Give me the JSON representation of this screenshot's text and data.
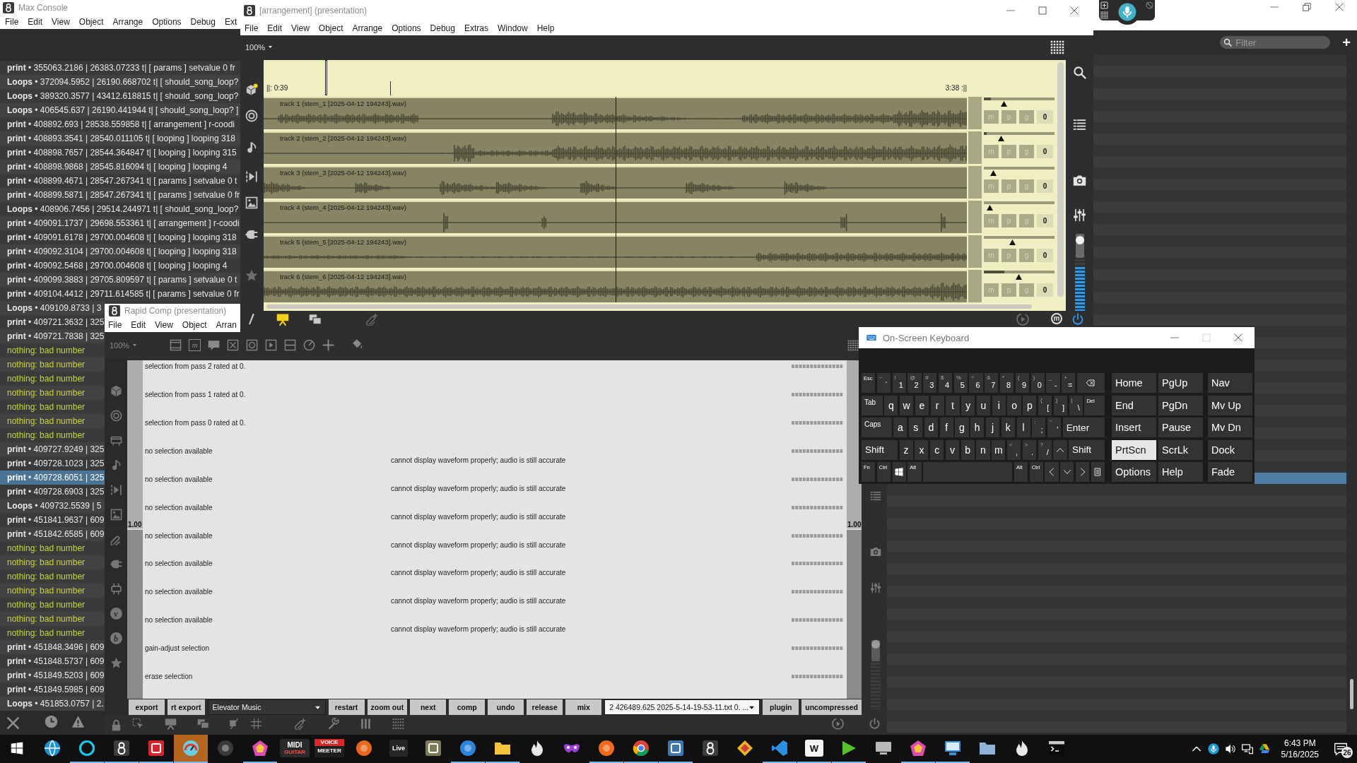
{
  "browser": {
    "search": {
      "placeholder": "Filter"
    },
    "add": "+",
    "rows": [
      {
        "selected": false
      },
      {
        "selected": false
      },
      {
        "selected": false
      },
      {
        "selected": false
      },
      {
        "selected": false
      },
      {
        "selected": false
      },
      {
        "selected": false
      },
      {
        "selected": false
      },
      {
        "selected": false
      },
      {
        "selected": false
      },
      {
        "selected": false
      },
      {
        "selected": false
      },
      {
        "selected": false
      },
      {
        "selected": false
      },
      {
        "selected": false
      },
      {
        "selected": false
      },
      {
        "selected": false
      },
      {
        "selected": false
      },
      {
        "selected": false
      },
      {
        "selected": false
      },
      {
        "selected": false
      },
      {
        "selected": false
      },
      {
        "selected": false
      },
      {
        "selected": false
      },
      {
        "selected": false
      },
      {
        "selected": false
      },
      {
        "selected": false
      },
      {
        "selected": false
      },
      {
        "selected": false
      },
      {
        "selected": false
      },
      {
        "selected": false
      },
      {
        "selected": false
      },
      {
        "selected": false
      },
      {
        "selected": false
      },
      {
        "selected": false
      },
      {
        "selected": false
      },
      {
        "selected": false
      },
      {
        "selected": true
      },
      {
        "selected": false
      },
      {
        "selected": false
      },
      {
        "selected": false
      },
      {
        "selected": false
      },
      {
        "selected": false
      },
      {
        "selected": false
      },
      {
        "selected": false
      },
      {
        "selected": false
      },
      {
        "selected": false
      },
      {
        "selected": false
      },
      {
        "selected": false
      },
      {
        "selected": false
      },
      {
        "selected": false
      },
      {
        "selected": false
      },
      {
        "selected": false
      },
      {
        "selected": false
      },
      {
        "selected": false
      },
      {
        "selected": false
      },
      {
        "selected": false
      },
      {
        "selected": false
      },
      {
        "selected": false
      },
      {
        "selected": false
      }
    ]
  },
  "console": {
    "title": "Max Console",
    "menu": [
      "File",
      "Edit",
      "View",
      "Object",
      "Arrange",
      "Options",
      "Debug",
      "Ext"
    ],
    "rows": [
      {
        "kind": "print",
        "text": "**print** • 355063.2186 | 26383.07233 t| [ params ] setvalue 0 fr",
        "selected": false
      },
      {
        "kind": "loops",
        "text": "**Loops** • 372094.5952 | 26190.668702 t| [ should_song_loop?",
        "selected": false
      },
      {
        "kind": "loops",
        "text": "**Loops** • 389320.3577 | 43412.618815 t| [ should_song_loop?",
        "selected": false
      },
      {
        "kind": "loops",
        "text": "**Loops** • 406545.637 | 26190.441944 t| [ should_song_loop? ]",
        "selected": false
      },
      {
        "kind": "print",
        "text": "**print** • 408892.693 | 28538.559858 t| [ arrangement ] r-coodi",
        "selected": false
      },
      {
        "kind": "print",
        "text": "**print** • 408893.3541 | 28540.011105 t| [ looping ] looping 318",
        "selected": false
      },
      {
        "kind": "print",
        "text": "**print** • 408898.7657 | 28544.364847 t| [ looping ] looping 315",
        "selected": false
      },
      {
        "kind": "print",
        "text": "**print** • 408898.9868 | 28545.816094 t| [ looping ] looping 4",
        "selected": false
      },
      {
        "kind": "print",
        "text": "**print** • 408899.4671 | 28547.267341 t| [ params ] setvalue 0 t",
        "selected": false
      },
      {
        "kind": "print",
        "text": "**print** • 408899.5871 | 28547.267341 t| [ params ] setvalue 0 fr",
        "selected": false
      },
      {
        "kind": "loops",
        "text": "**Loops** • 408906.7456 | 29514.244971 t| [ should_song_loop?",
        "selected": false
      },
      {
        "kind": "print",
        "text": "**print** • 409091.1737 | 29698.553361 t| [ arrangement ] r-coodi",
        "selected": false
      },
      {
        "kind": "print",
        "text": "**print** • 409091.6178 | 29700.004608 t| [ looping ] looping 318",
        "selected": false
      },
      {
        "kind": "print",
        "text": "**print** • 409092.3104 | 29700.004608 t| [ looping ] looping 318",
        "selected": false
      },
      {
        "kind": "print",
        "text": "**print** • 409092.5468 | 29700.004608 t| [ looping ] looping 4",
        "selected": false
      },
      {
        "kind": "print",
        "text": "**print** • 409099.3883 | 29705.809597 t| [ params ] setvalue 0 t",
        "selected": false
      },
      {
        "kind": "print",
        "text": "**print** • 409104.4412 | 29711.614585 t| [ params ] setvalue 0 fr",
        "selected": false
      },
      {
        "kind": "loops",
        "text": "**Loops** • 409109.8733 | 3",
        "selected": false
      },
      {
        "kind": "print",
        "text": "**print** • 409721.3632 | 325",
        "selected": false
      },
      {
        "kind": "print",
        "text": "**print** • 409721.7838 | 325",
        "selected": false
      },
      {
        "kind": "error",
        "text": "nothing: bad number",
        "selected": false
      },
      {
        "kind": "error",
        "text": "nothing: bad number",
        "selected": false
      },
      {
        "kind": "error",
        "text": "nothing: bad number",
        "selected": false
      },
      {
        "kind": "error",
        "text": "nothing: bad number",
        "selected": false
      },
      {
        "kind": "error",
        "text": "nothing: bad number",
        "selected": false
      },
      {
        "kind": "error",
        "text": "nothing: bad number",
        "selected": false
      },
      {
        "kind": "error",
        "text": "nothing: bad number",
        "selected": false
      },
      {
        "kind": "print",
        "text": "**print** • 409727.9249 | 325",
        "selected": false
      },
      {
        "kind": "print",
        "text": "**print** • 409728.1023 | 325",
        "selected": false
      },
      {
        "kind": "print",
        "text": "**print** • 409728.6051 | 325",
        "selected": true
      },
      {
        "kind": "print",
        "text": "**print** • 409728.6903 | 325",
        "selected": false
      },
      {
        "kind": "loops",
        "text": "**Loops** • 409732.5539 | 5",
        "selected": false
      },
      {
        "kind": "print",
        "text": "**print** • 451841.9637 | 609",
        "selected": false
      },
      {
        "kind": "print",
        "text": "**print** • 451842.6585 | 609",
        "selected": false
      },
      {
        "kind": "error",
        "text": "nothing: bad number",
        "selected": false
      },
      {
        "kind": "error",
        "text": "nothing: bad number",
        "selected": false
      },
      {
        "kind": "error",
        "text": "nothing: bad number",
        "selected": false
      },
      {
        "kind": "error",
        "text": "nothing: bad number",
        "selected": false
      },
      {
        "kind": "error",
        "text": "nothing: bad number",
        "selected": false
      },
      {
        "kind": "error",
        "text": "nothing: bad number",
        "selected": false
      },
      {
        "kind": "error",
        "text": "nothing: bad number",
        "selected": false
      },
      {
        "kind": "print",
        "text": "**print** • 451848.3496 | 609",
        "selected": false
      },
      {
        "kind": "print",
        "text": "**print** • 451848.5737 | 609",
        "selected": false
      },
      {
        "kind": "print",
        "text": "**print** • 451849.5203 | 609",
        "selected": false
      },
      {
        "kind": "print",
        "text": "**print** • 451849.5985 | 609",
        "selected": false
      },
      {
        "kind": "loops",
        "text": "**Loops** • 451853.0757 | 2.",
        "selected": false
      }
    ]
  },
  "rapid_comp": {
    "title": "Rapid Comp (presentation)",
    "menu": [
      "File",
      "Edit",
      "View",
      "Object",
      "Arran"
    ],
    "zoom": "100%",
    "message_tool": "m",
    "badges": [
      "v",
      "b"
    ],
    "left_slider": {
      "value": "1.00",
      "level": 0.5
    },
    "right_slider": {
      "value": "1.00",
      "level": 0.5
    },
    "rows": [
      {
        "label": "selection from pass 2 rated at 0."
      },
      {
        "label": "selection from pass 1 rated at 0."
      },
      {
        "label": "selection from pass 0 rated at 0."
      },
      {
        "label": "no selection available",
        "note": "cannot display waveform properly; audio is still accurate"
      },
      {
        "label": "no selection available",
        "note": "cannot display waveform properly; audio is still accurate"
      },
      {
        "label": "no selection available",
        "note": "cannot display waveform properly; audio is still accurate"
      },
      {
        "label": "no selection available",
        "note": "cannot display waveform properly; audio is still accurate"
      },
      {
        "label": "no selection available",
        "note": "cannot display waveform properly; audio is still accurate"
      },
      {
        "label": "no selection available",
        "note": "cannot display waveform properly; audio is still accurate"
      },
      {
        "label": "no selection available",
        "note": "cannot display waveform properly; audio is still accurate"
      },
      {
        "label": "gain-adjust selection"
      },
      {
        "label": "erase selection"
      }
    ],
    "controls": [
      {
        "kind": "button",
        "label": "export"
      },
      {
        "kind": "button",
        "label": "rt export"
      },
      {
        "kind": "dropdown",
        "label": "Elevator Music"
      },
      {
        "kind": "button",
        "label": "restart"
      },
      {
        "kind": "button",
        "label": "zoom out"
      },
      {
        "kind": "button",
        "label": "next"
      },
      {
        "kind": "button",
        "label": "comp"
      },
      {
        "kind": "button",
        "label": "undo"
      },
      {
        "kind": "button",
        "label": "release"
      },
      {
        "kind": "button",
        "label": "mix"
      },
      {
        "kind": "file-dropdown",
        "label": "2 426489.625 2025-5-14-19-53-11.txt 0. ..."
      },
      {
        "kind": "button",
        "label": "plugin"
      },
      {
        "kind": "button",
        "label": "uncompressed"
      }
    ],
    "output": {
      "gain": {
        "level": 0.8
      }
    }
  },
  "arrangement": {
    "title": "[arrangement] (presentation)",
    "menu": [
      "File",
      "Edit",
      "View",
      "Object",
      "Arrange",
      "Options",
      "Debug",
      "Extras",
      "Window",
      "Help"
    ],
    "zoom": "100%",
    "loop_start": "||: 0:39",
    "loop_end": "3:38 :||",
    "marker": {
      "level": 0.087
    },
    "cursor": {
      "level": 0.18
    },
    "playhead": {
      "level": 0.5
    },
    "letter_button": "m",
    "tracks": [
      {
        "label": "track 1 (stem_1 [2025-04-12 194243].wav)",
        "meter": {
          "level": 0.1
        },
        "gain": {
          "level": 0.28
        },
        "buttons": [
          "m",
          "p",
          "g"
        ],
        "value": "0"
      },
      {
        "label": "track 2 (stem_2 [2025-04-12 194243].wav)",
        "meter": {
          "level": 0.04
        },
        "gain": {
          "level": 0.24
        },
        "buttons": [
          "m",
          "p",
          "g"
        ],
        "value": "0"
      },
      {
        "label": "track 3 (stem_3 [2025-04-12 194243].wav)",
        "gain": {
          "level": 0.13
        },
        "buttons": [
          "m",
          "p",
          "g"
        ],
        "value": "0"
      },
      {
        "label": "track 4 (stem_4 [2025-04-12 194243].wav)",
        "gain": {
          "level": 0.08
        },
        "buttons": [
          "m",
          "p",
          "g"
        ],
        "value": "0"
      },
      {
        "label": "track 5 (stem_5 [2025-04-12 194243].wav)",
        "gain": {
          "level": 0.4
        },
        "buttons": [
          "m",
          "p",
          "g"
        ],
        "value": "0"
      },
      {
        "label": "track 6 (stem_6 [2025-04-12 194243].wav)",
        "meter": {
          "level": 0.29
        },
        "gain": {
          "level": 0.49
        },
        "buttons": [
          "m",
          "p",
          "g"
        ],
        "value": "0"
      }
    ],
    "output": {
      "gain": {
        "level": 0.75
      },
      "meter": {
        "level": 0.85
      }
    }
  },
  "keyboard": {
    "title": "On-Screen Keyboard",
    "main_rows": [
      [
        {
          "kind": "tiny",
          "label": "Esc"
        },
        {
          "kind": "dual",
          "shift": "~",
          "label": "`"
        },
        {
          "kind": "dual",
          "shift": "!",
          "label": "1"
        },
        {
          "kind": "dual",
          "shift": "@",
          "label": "2"
        },
        {
          "kind": "dual",
          "shift": "#",
          "label": "3"
        },
        {
          "kind": "dual",
          "shift": "$",
          "label": "4"
        },
        {
          "kind": "dual",
          "shift": "%",
          "label": "5"
        },
        {
          "kind": "dual",
          "shift": "^",
          "label": "6"
        },
        {
          "kind": "dual",
          "shift": "&",
          "label": "7"
        },
        {
          "kind": "dual",
          "shift": "*",
          "label": "8"
        },
        {
          "kind": "dual",
          "shift": "(",
          "label": "9"
        },
        {
          "kind": "dual",
          "shift": ")",
          "label": "0"
        },
        {
          "kind": "dual",
          "shift": "_",
          "label": "-"
        },
        {
          "kind": "dual",
          "shift": "+",
          "label": "="
        },
        {
          "kind": "backspace"
        }
      ],
      [
        {
          "kind": "small",
          "label": "Tab"
        },
        {
          "kind": "letter",
          "label": "q"
        },
        {
          "kind": "letter",
          "label": "w"
        },
        {
          "kind": "letter",
          "label": "e"
        },
        {
          "kind": "letter",
          "label": "r"
        },
        {
          "kind": "letter",
          "label": "t"
        },
        {
          "kind": "letter",
          "label": "y"
        },
        {
          "kind": "letter",
          "label": "u"
        },
        {
          "kind": "letter",
          "label": "i"
        },
        {
          "kind": "letter",
          "label": "o"
        },
        {
          "kind": "letter",
          "label": "p"
        },
        {
          "kind": "dual",
          "shift": "{",
          "label": "["
        },
        {
          "kind": "dual",
          "shift": "}",
          "label": "]"
        },
        {
          "kind": "dual",
          "shift": "|",
          "label": "\\"
        },
        {
          "kind": "tiny-wide",
          "label": "Del"
        }
      ],
      [
        {
          "kind": "small",
          "label": "Caps"
        },
        {
          "kind": "letter",
          "label": "a"
        },
        {
          "kind": "letter",
          "label": "s"
        },
        {
          "kind": "letter",
          "label": "d"
        },
        {
          "kind": "letter",
          "label": "f"
        },
        {
          "kind": "letter",
          "label": "g"
        },
        {
          "kind": "letter",
          "label": "h"
        },
        {
          "kind": "letter",
          "label": "j"
        },
        {
          "kind": "letter",
          "label": "k"
        },
        {
          "kind": "letter",
          "label": "l"
        },
        {
          "kind": "dual",
          "shift": ":",
          "label": ";"
        },
        {
          "kind": "dual",
          "shift": "\"",
          "label": "'"
        },
        {
          "kind": "enter",
          "label": "Enter"
        }
      ],
      [
        {
          "kind": "wide",
          "label": "Shift"
        },
        {
          "kind": "letter",
          "label": "z"
        },
        {
          "kind": "letter",
          "label": "x"
        },
        {
          "kind": "letter",
          "label": "c"
        },
        {
          "kind": "letter",
          "label": "v"
        },
        {
          "kind": "letter",
          "label": "b"
        },
        {
          "kind": "letter",
          "label": "n"
        },
        {
          "kind": "letter",
          "label": "m"
        },
        {
          "kind": "dual",
          "shift": "<",
          "label": ","
        },
        {
          "kind": "dual",
          "shift": ">",
          "label": "."
        },
        {
          "kind": "dual",
          "shift": "?",
          "label": "/"
        },
        {
          "kind": "up"
        },
        {
          "kind": "wide",
          "label": "Shift"
        }
      ],
      [
        {
          "kind": "tiny",
          "label": "Fn"
        },
        {
          "kind": "tiny",
          "label": "Ctrl"
        },
        {
          "kind": "windows"
        },
        {
          "kind": "tiny",
          "label": "Alt"
        },
        {
          "kind": "space"
        },
        {
          "kind": "tiny",
          "label": "Alt"
        },
        {
          "kind": "tiny",
          "label": "Ctrl"
        },
        {
          "kind": "left"
        },
        {
          "kind": "down"
        },
        {
          "kind": "right"
        },
        {
          "kind": "menu"
        }
      ]
    ],
    "side_rows": [
      [
        {
          "label": "Home",
          "pressed": false
        },
        {
          "label": "PgUp",
          "pressed": false
        },
        {
          "label": "Nav",
          "pressed": false
        }
      ],
      [
        {
          "label": "End",
          "pressed": false
        },
        {
          "label": "PgDn",
          "pressed": false
        },
        {
          "label": "Mv Up",
          "pressed": false
        }
      ],
      [
        {
          "label": "Insert",
          "pressed": false
        },
        {
          "label": "Pause",
          "pressed": false
        },
        {
          "label": "Mv Dn",
          "pressed": false
        }
      ],
      [
        {
          "label": "PrtScn",
          "pressed": true
        },
        {
          "label": "ScrLk",
          "pressed": false
        },
        {
          "label": "Dock",
          "pressed": false
        }
      ],
      [
        {
          "label": "Options",
          "pressed": false
        },
        {
          "label": "Help",
          "pressed": false
        },
        {
          "label": "Fade",
          "pressed": false
        }
      ]
    ]
  },
  "taskbar": {
    "apps": [
      {
        "kind": "globe",
        "color": "#1e90d6",
        "selected": false,
        "running": false
      },
      {
        "kind": "ring",
        "color": "#1cc7ea",
        "selected": false,
        "running": true
      },
      {
        "kind": "loops",
        "color": "#3c3c3c",
        "selected": false,
        "running": true
      },
      {
        "kind": "tile",
        "color": "#d3262d",
        "selected": false,
        "running": true
      },
      {
        "kind": "gauge",
        "color": "#6ccde4",
        "selected": true,
        "running": true
      },
      {
        "kind": "disc",
        "color": "#3a3a3a",
        "selected": false,
        "running": false
      },
      {
        "kind": "pentagon",
        "color": "#d94bb0",
        "selected": false,
        "running": true
      },
      {
        "kind": "stacked-logo",
        "color": "#2a2a2a",
        "text": "MIDI",
        "subtext": "GUITAR",
        "selected": false,
        "running": false
      },
      {
        "kind": "band-logo",
        "color": "#d62828",
        "text": "VOICE",
        "subtext": "MEETER",
        "selected": false,
        "running": false
      },
      {
        "kind": "disc",
        "color": "#e8661e",
        "selected": false,
        "running": false
      },
      {
        "kind": "text-tile",
        "color": "#262626",
        "text": "Live",
        "selected": false,
        "running": false
      },
      {
        "kind": "tile",
        "color": "#7d7a5a",
        "selected": false,
        "running": false
      },
      {
        "kind": "disc",
        "color": "#2b86d9",
        "selected": false,
        "running": true
      },
      {
        "kind": "folder",
        "color": "#f3c33f",
        "selected": false,
        "running": true
      },
      {
        "kind": "flame",
        "color": "#e8e8e8",
        "selected": false,
        "running": false
      },
      {
        "kind": "mask",
        "color": "#9b3fd8",
        "selected": false,
        "running": false
      },
      {
        "kind": "disc",
        "color": "#f06a1d",
        "selected": false,
        "running": true
      },
      {
        "kind": "chrome",
        "color": "#db4437",
        "selected": false,
        "running": true
      },
      {
        "kind": "tile",
        "color": "#3d78b0",
        "selected": false,
        "running": true
      },
      {
        "kind": "loops",
        "color": "#3c3c3c",
        "selected": false,
        "running": false
      },
      {
        "kind": "diamond",
        "color": "#e8b61f",
        "selected": false,
        "running": false
      },
      {
        "kind": "code",
        "color": "#2a8fe0",
        "selected": false,
        "running": true
      },
      {
        "kind": "text-tile",
        "color": "#f5f5f5",
        "text": "W",
        "selected": false,
        "running": true
      },
      {
        "kind": "play",
        "color": "#55c12b",
        "selected": false,
        "running": true
      },
      {
        "kind": "computer",
        "color": "#b8b8b8",
        "selected": false,
        "running": false
      },
      {
        "kind": "pentagon",
        "color": "#d94bb0",
        "selected": false,
        "running": true
      },
      {
        "kind": "monitor",
        "color": "#3a8fd8",
        "selected": false,
        "running": true
      },
      {
        "kind": "folder",
        "color": "#8fb3d8",
        "selected": false,
        "running": false
      },
      {
        "kind": "flame",
        "color": "#e8e8e8",
        "selected": false,
        "running": false
      },
      {
        "kind": "terminal",
        "color": "#c8c8c8",
        "selected": false,
        "running": false
      }
    ],
    "clock": {
      "time": "6:43 PM",
      "date": "5/16/2025"
    },
    "notifications": "26"
  }
}
